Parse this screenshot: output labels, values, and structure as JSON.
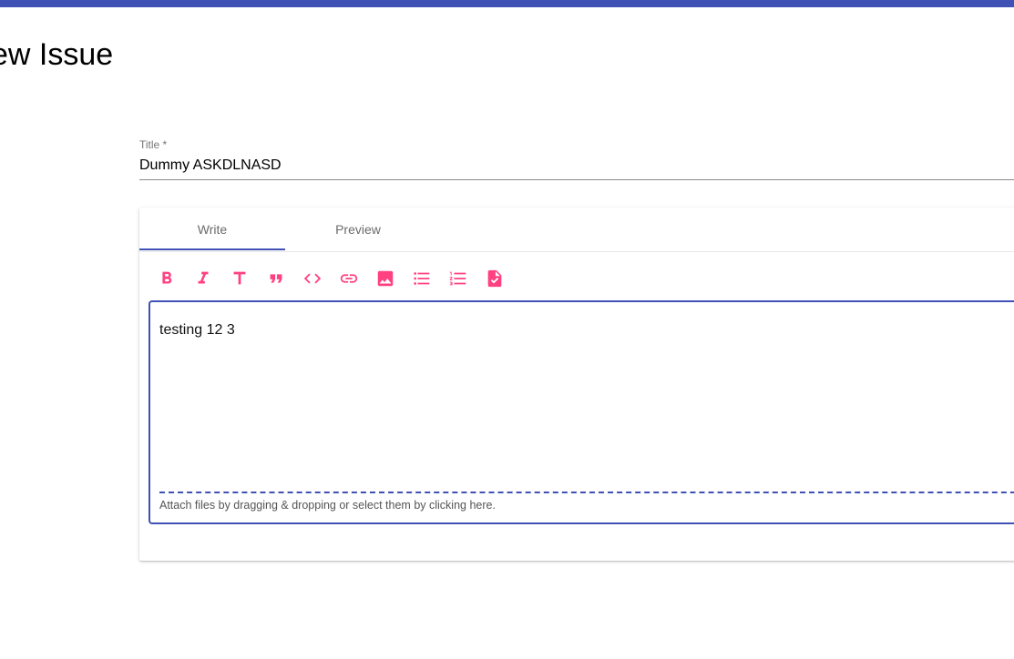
{
  "header": {
    "page_title": "ew Issue",
    "bar_color": "#3f51b5"
  },
  "form": {
    "title_label": "Title *",
    "title_value": "Dummy ASKDLNASD"
  },
  "editor": {
    "tabs": [
      {
        "label": "Write",
        "active": true
      },
      {
        "label": "Preview",
        "active": false
      }
    ],
    "toolbar": [
      "bold-icon",
      "italic-icon",
      "heading-icon",
      "quote-icon",
      "code-icon",
      "link-icon",
      "image-icon",
      "unordered-list-icon",
      "ordered-list-icon",
      "task-list-icon"
    ],
    "content": "testing 12 3",
    "attach_hint": "Attach files by dragging & dropping or select them by clicking here.",
    "accent_color": "#ff4081",
    "focus_color": "#3f51b5"
  }
}
